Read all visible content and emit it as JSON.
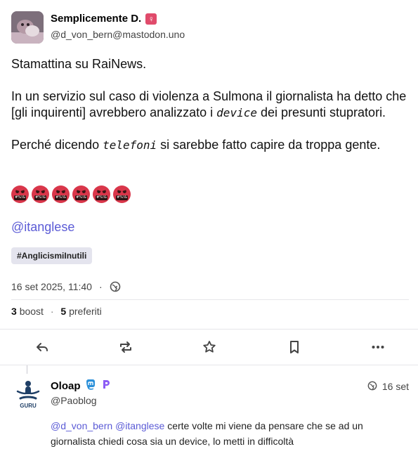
{
  "post": {
    "display_name": "Semplicemente D.",
    "name_badge": "♀",
    "handle": "@d_von_bern@mastodon.uno",
    "paragraphs": {
      "p1": "Stamattina su RaiNews.",
      "p2_a": "In un servizio sul caso di violenza a Sulmona il giornalista ha detto che [gli inquirenti] avrebbero analizzato i ",
      "p2_em": "device",
      "p2_b": " dei presunti stupratori.",
      "p3_a": "Perché dicendo ",
      "p3_em": "telefoni",
      "p3_b": " si sarebbe fatto capire da troppa gente."
    },
    "emoji_text": "#%!&",
    "emoji_count": 6,
    "mention": "@itanglese",
    "hashtag": "#AnglicismiInutili",
    "timestamp": "16 set 2025, 11:40",
    "separator": "·",
    "visibility_icon": "globe-icon",
    "boost_count": "3",
    "boost_label": "boost",
    "fav_count": "5",
    "fav_label": "preferiti"
  },
  "actions": [
    "reply-icon",
    "boost-icon",
    "favourite-icon",
    "bookmark-icon",
    "more-icon"
  ],
  "reply": {
    "display_name": "Oloap",
    "avatar_text": "GURU",
    "handle": "@Paoblog",
    "time": "16 set",
    "mention1": "@d_von_bern",
    "mention2": "@itanglese",
    "text": " certe volte mi viene da pensare che se ad un giornalista chiedi cosa sia un device, lo metti in difficoltà"
  },
  "colors": {
    "accent": "#5b5bd6",
    "emoji_red": "#d9364a",
    "hashtag_bg": "#e4e4ee",
    "mastodon_blue": "#2b90d9",
    "purple_p": "#8c5cf5"
  }
}
